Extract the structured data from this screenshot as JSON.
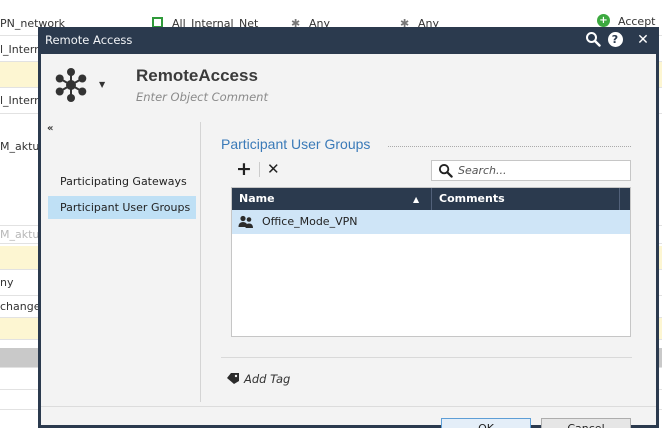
{
  "background": {
    "rows": [
      {
        "c1": "PN_network",
        "c2": "All_Internal_Net",
        "c3": "Any",
        "c4": "Any",
        "c5": "Accept"
      },
      {
        "c1": "l_Intern"
      },
      {
        "c1": "l_Intern"
      },
      {
        "c1": "M_aktue"
      },
      {
        "c1": "M_aktue"
      },
      {
        "c1": "ny"
      },
      {
        "c1": "change"
      }
    ]
  },
  "dialog": {
    "title": "Remote Access",
    "object_name": "RemoteAccess",
    "object_comment_placeholder": "Enter Object Comment",
    "collapse_label": "«",
    "nav": [
      {
        "label": "Participating Gateways",
        "active": false
      },
      {
        "label": "Participant User Groups",
        "active": true
      }
    ],
    "section_title": "Participant User Groups",
    "toolbar": {
      "add_icon": "+",
      "remove_icon": "✕"
    },
    "search": {
      "placeholder": "Search..."
    },
    "grid": {
      "columns": [
        "Name",
        "Comments"
      ],
      "sort_indicator": "▲",
      "rows": [
        {
          "name": "Office_Mode_VPN",
          "comments": "",
          "icon": "user-group-icon"
        }
      ]
    },
    "add_tag_label": "Add Tag",
    "buttons": {
      "ok": "OK",
      "cancel": "Cancel"
    },
    "titlebar_icons": [
      "search-icon",
      "help-icon",
      "close-icon"
    ]
  },
  "colors": {
    "titlebar": "#2b3a4e",
    "accent": "#3a7ab8",
    "selected_row": "#cfe5f7",
    "selected_nav": "#bfe0f5"
  }
}
